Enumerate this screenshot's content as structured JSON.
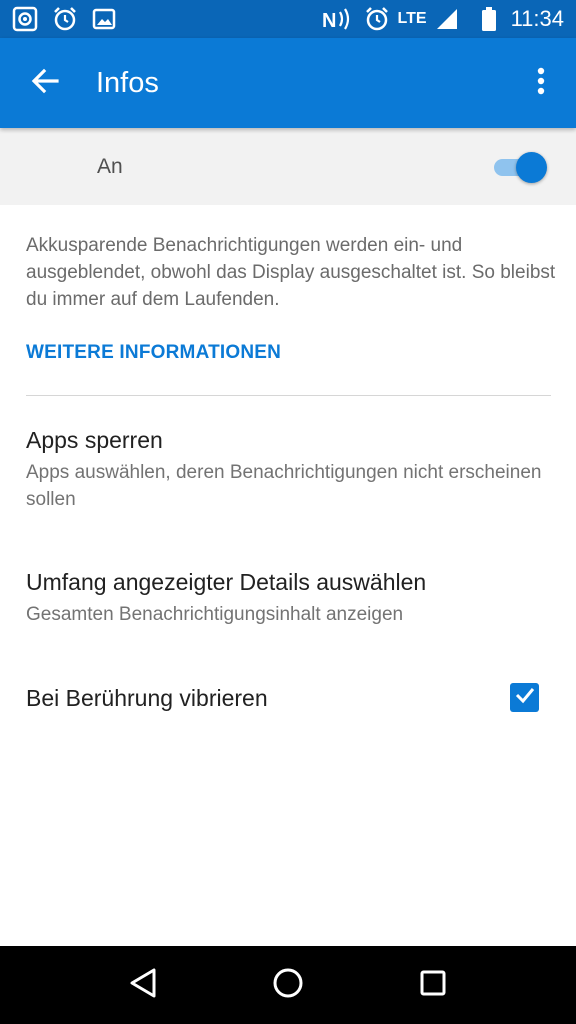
{
  "status_bar": {
    "network_type": "LTE",
    "time": "11:34",
    "left_icons": [
      "camera-icon",
      "alarm-icon",
      "image-icon"
    ],
    "right_icons": [
      "nfc-icon",
      "alarm-icon",
      "signal-icon",
      "battery-icon"
    ]
  },
  "toolbar": {
    "title": "Infos",
    "back_icon": "arrow-back-icon",
    "menu_icon": "more-vert-icon"
  },
  "master_switch": {
    "label": "An",
    "on": true
  },
  "content": {
    "description": "Akkusparende Benachrichtigungen werden ein- und ausgeblendet, obwohl das Display ausgeschaltet ist. So bleibst du immer auf dem Laufenden.",
    "more_link": "WEITERE INFORMATIONEN"
  },
  "preferences": [
    {
      "title": "Apps sperren",
      "summary": "Apps auswählen, deren Benachrichtigungen nicht erscheinen sollen"
    },
    {
      "title": "Umfang angezeigter Details auswählen",
      "summary": "Gesamten Benachrichtigungsinhalt anzeigen"
    },
    {
      "title": "Bei Berührung vibrieren",
      "checked": true
    }
  ],
  "nav_bar": {
    "icons": [
      "back-triangle-icon",
      "home-circle-icon",
      "recents-square-icon"
    ]
  },
  "colors": {
    "status_bar": "#0a66b7",
    "toolbar": "#0b7ad6",
    "accent": "#0b7ad6",
    "switch_track": "#8fc3ee",
    "master_row_bg": "#f2f2f2"
  }
}
